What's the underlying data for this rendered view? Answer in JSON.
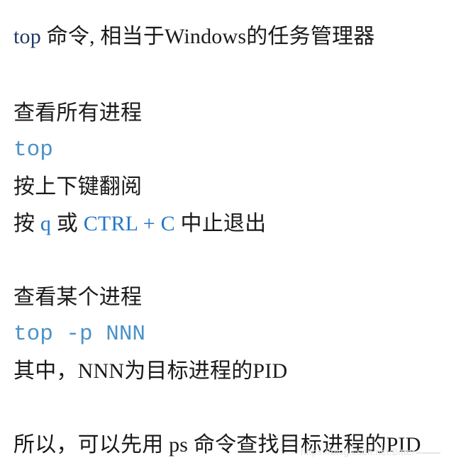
{
  "page": {
    "background_color": "#ffffff",
    "text_color": "#1a1a1a",
    "navy_accent": "#1f3864",
    "blue_accent": "#2577c7",
    "code_color": "#4a92c8",
    "watermark_color": "#e3e3e3"
  },
  "title_line": {
    "command": "top",
    "rest": " 命令, 相当于Windows的任务管理器"
  },
  "sections": [
    {
      "heading": "查看所有进程",
      "code": "top",
      "lines": [
        {
          "plain_1": "按上下键翻阅"
        },
        {
          "prefix": "按 ",
          "key1": "q",
          "middle": " 或 ",
          "key2": "CTRL + C",
          "suffix": " 中止退出"
        }
      ]
    },
    {
      "heading": "查看某个进程",
      "code": "top -p NNN",
      "note": "其中，NNN为目标进程的PID"
    }
  ],
  "closing_line": "所以，可以先用 ps 命令查找目标进程的PID",
  "watermark": {
    "text": "https://blog.csdn.net/Bitter"
  }
}
